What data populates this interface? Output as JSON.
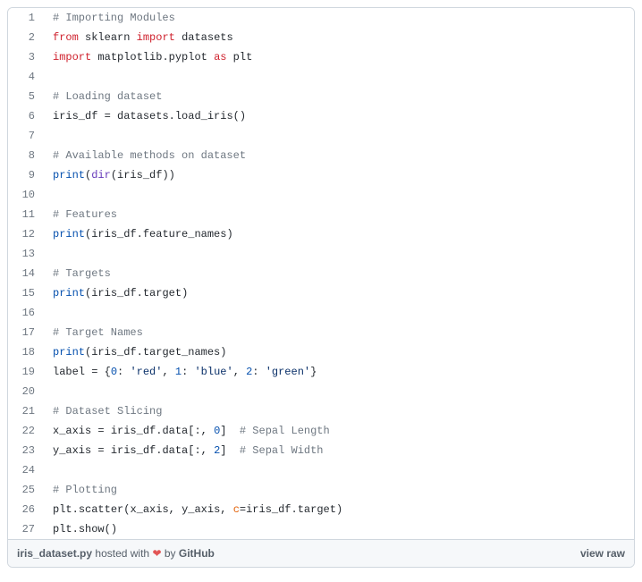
{
  "lines": [
    {
      "n": 1,
      "tokens": [
        {
          "t": "# Importing Modules",
          "c": "tok-comment"
        }
      ]
    },
    {
      "n": 2,
      "tokens": [
        {
          "t": "from",
          "c": "tok-keyword"
        },
        {
          "t": " ",
          "c": ""
        },
        {
          "t": "sklearn",
          "c": "tok-name"
        },
        {
          "t": " ",
          "c": ""
        },
        {
          "t": "import",
          "c": "tok-keyword"
        },
        {
          "t": " ",
          "c": ""
        },
        {
          "t": "datasets",
          "c": "tok-name"
        }
      ]
    },
    {
      "n": 3,
      "tokens": [
        {
          "t": "import",
          "c": "tok-keyword"
        },
        {
          "t": " ",
          "c": ""
        },
        {
          "t": "matplotlib",
          "c": "tok-name"
        },
        {
          "t": ".",
          "c": "tok-op"
        },
        {
          "t": "pyplot",
          "c": "tok-name"
        },
        {
          "t": " ",
          "c": ""
        },
        {
          "t": "as",
          "c": "tok-keyword"
        },
        {
          "t": " ",
          "c": ""
        },
        {
          "t": "plt",
          "c": "tok-name"
        }
      ]
    },
    {
      "n": 4,
      "tokens": []
    },
    {
      "n": 5,
      "tokens": [
        {
          "t": "# Loading dataset",
          "c": "tok-comment"
        }
      ]
    },
    {
      "n": 6,
      "tokens": [
        {
          "t": "iris_df",
          "c": "tok-name"
        },
        {
          "t": " ",
          "c": ""
        },
        {
          "t": "=",
          "c": "tok-op"
        },
        {
          "t": " ",
          "c": ""
        },
        {
          "t": "datasets",
          "c": "tok-name"
        },
        {
          "t": ".",
          "c": "tok-op"
        },
        {
          "t": "load_iris",
          "c": "tok-name"
        },
        {
          "t": "()",
          "c": "tok-op"
        }
      ]
    },
    {
      "n": 7,
      "tokens": []
    },
    {
      "n": 8,
      "tokens": [
        {
          "t": "# Available methods on dataset",
          "c": "tok-comment"
        }
      ]
    },
    {
      "n": 9,
      "tokens": [
        {
          "t": "print",
          "c": "tok-builtin"
        },
        {
          "t": "(",
          "c": "tok-op"
        },
        {
          "t": "dir",
          "c": "tok-func"
        },
        {
          "t": "(",
          "c": "tok-op"
        },
        {
          "t": "iris_df",
          "c": "tok-name"
        },
        {
          "t": "))",
          "c": "tok-op"
        }
      ]
    },
    {
      "n": 10,
      "tokens": []
    },
    {
      "n": 11,
      "tokens": [
        {
          "t": "# Features",
          "c": "tok-comment"
        }
      ]
    },
    {
      "n": 12,
      "tokens": [
        {
          "t": "print",
          "c": "tok-builtin"
        },
        {
          "t": "(",
          "c": "tok-op"
        },
        {
          "t": "iris_df",
          "c": "tok-name"
        },
        {
          "t": ".",
          "c": "tok-op"
        },
        {
          "t": "feature_names",
          "c": "tok-name"
        },
        {
          "t": ")",
          "c": "tok-op"
        }
      ]
    },
    {
      "n": 13,
      "tokens": []
    },
    {
      "n": 14,
      "tokens": [
        {
          "t": "# Targets",
          "c": "tok-comment"
        }
      ]
    },
    {
      "n": 15,
      "tokens": [
        {
          "t": "print",
          "c": "tok-builtin"
        },
        {
          "t": "(",
          "c": "tok-op"
        },
        {
          "t": "iris_df",
          "c": "tok-name"
        },
        {
          "t": ".",
          "c": "tok-op"
        },
        {
          "t": "target",
          "c": "tok-name"
        },
        {
          "t": ")",
          "c": "tok-op"
        }
      ]
    },
    {
      "n": 16,
      "tokens": []
    },
    {
      "n": 17,
      "tokens": [
        {
          "t": "# Target Names",
          "c": "tok-comment"
        }
      ]
    },
    {
      "n": 18,
      "tokens": [
        {
          "t": "print",
          "c": "tok-builtin"
        },
        {
          "t": "(",
          "c": "tok-op"
        },
        {
          "t": "iris_df",
          "c": "tok-name"
        },
        {
          "t": ".",
          "c": "tok-op"
        },
        {
          "t": "target_names",
          "c": "tok-name"
        },
        {
          "t": ")",
          "c": "tok-op"
        }
      ]
    },
    {
      "n": 19,
      "tokens": [
        {
          "t": "label",
          "c": "tok-name"
        },
        {
          "t": " ",
          "c": ""
        },
        {
          "t": "=",
          "c": "tok-op"
        },
        {
          "t": " {",
          "c": "tok-op"
        },
        {
          "t": "0",
          "c": "tok-number"
        },
        {
          "t": ": ",
          "c": "tok-op"
        },
        {
          "t": "'red'",
          "c": "tok-string"
        },
        {
          "t": ", ",
          "c": "tok-op"
        },
        {
          "t": "1",
          "c": "tok-number"
        },
        {
          "t": ": ",
          "c": "tok-op"
        },
        {
          "t": "'blue'",
          "c": "tok-string"
        },
        {
          "t": ", ",
          "c": "tok-op"
        },
        {
          "t": "2",
          "c": "tok-number"
        },
        {
          "t": ": ",
          "c": "tok-op"
        },
        {
          "t": "'green'",
          "c": "tok-string"
        },
        {
          "t": "}",
          "c": "tok-op"
        }
      ]
    },
    {
      "n": 20,
      "tokens": []
    },
    {
      "n": 21,
      "tokens": [
        {
          "t": "# Dataset Slicing",
          "c": "tok-comment"
        }
      ]
    },
    {
      "n": 22,
      "tokens": [
        {
          "t": "x_axis",
          "c": "tok-name"
        },
        {
          "t": " ",
          "c": ""
        },
        {
          "t": "=",
          "c": "tok-op"
        },
        {
          "t": " ",
          "c": ""
        },
        {
          "t": "iris_df",
          "c": "tok-name"
        },
        {
          "t": ".",
          "c": "tok-op"
        },
        {
          "t": "data",
          "c": "tok-name"
        },
        {
          "t": "[:, ",
          "c": "tok-op"
        },
        {
          "t": "0",
          "c": "tok-number"
        },
        {
          "t": "]  ",
          "c": "tok-op"
        },
        {
          "t": "# Sepal Length",
          "c": "tok-comment"
        }
      ]
    },
    {
      "n": 23,
      "tokens": [
        {
          "t": "y_axis",
          "c": "tok-name"
        },
        {
          "t": " ",
          "c": ""
        },
        {
          "t": "=",
          "c": "tok-op"
        },
        {
          "t": " ",
          "c": ""
        },
        {
          "t": "iris_df",
          "c": "tok-name"
        },
        {
          "t": ".",
          "c": "tok-op"
        },
        {
          "t": "data",
          "c": "tok-name"
        },
        {
          "t": "[:, ",
          "c": "tok-op"
        },
        {
          "t": "2",
          "c": "tok-number"
        },
        {
          "t": "]  ",
          "c": "tok-op"
        },
        {
          "t": "# Sepal Width",
          "c": "tok-comment"
        }
      ]
    },
    {
      "n": 24,
      "tokens": []
    },
    {
      "n": 25,
      "tokens": [
        {
          "t": "# Plotting",
          "c": "tok-comment"
        }
      ]
    },
    {
      "n": 26,
      "tokens": [
        {
          "t": "plt",
          "c": "tok-name"
        },
        {
          "t": ".",
          "c": "tok-op"
        },
        {
          "t": "scatter",
          "c": "tok-name"
        },
        {
          "t": "(",
          "c": "tok-op"
        },
        {
          "t": "x_axis",
          "c": "tok-name"
        },
        {
          "t": ", ",
          "c": "tok-op"
        },
        {
          "t": "y_axis",
          "c": "tok-name"
        },
        {
          "t": ", ",
          "c": "tok-op"
        },
        {
          "t": "c",
          "c": "tok-kwarg"
        },
        {
          "t": "=",
          "c": "tok-op"
        },
        {
          "t": "iris_df",
          "c": "tok-name"
        },
        {
          "t": ".",
          "c": "tok-op"
        },
        {
          "t": "target",
          "c": "tok-name"
        },
        {
          "t": ")",
          "c": "tok-op"
        }
      ]
    },
    {
      "n": 27,
      "tokens": [
        {
          "t": "plt",
          "c": "tok-name"
        },
        {
          "t": ".",
          "c": "tok-op"
        },
        {
          "t": "show",
          "c": "tok-name"
        },
        {
          "t": "()",
          "c": "tok-op"
        }
      ]
    }
  ],
  "footer": {
    "filename": "iris_dataset.py",
    "hosted_prefix": " hosted with ",
    "heart": "❤",
    "by": " by ",
    "host": "GitHub",
    "view_raw": "view raw"
  }
}
